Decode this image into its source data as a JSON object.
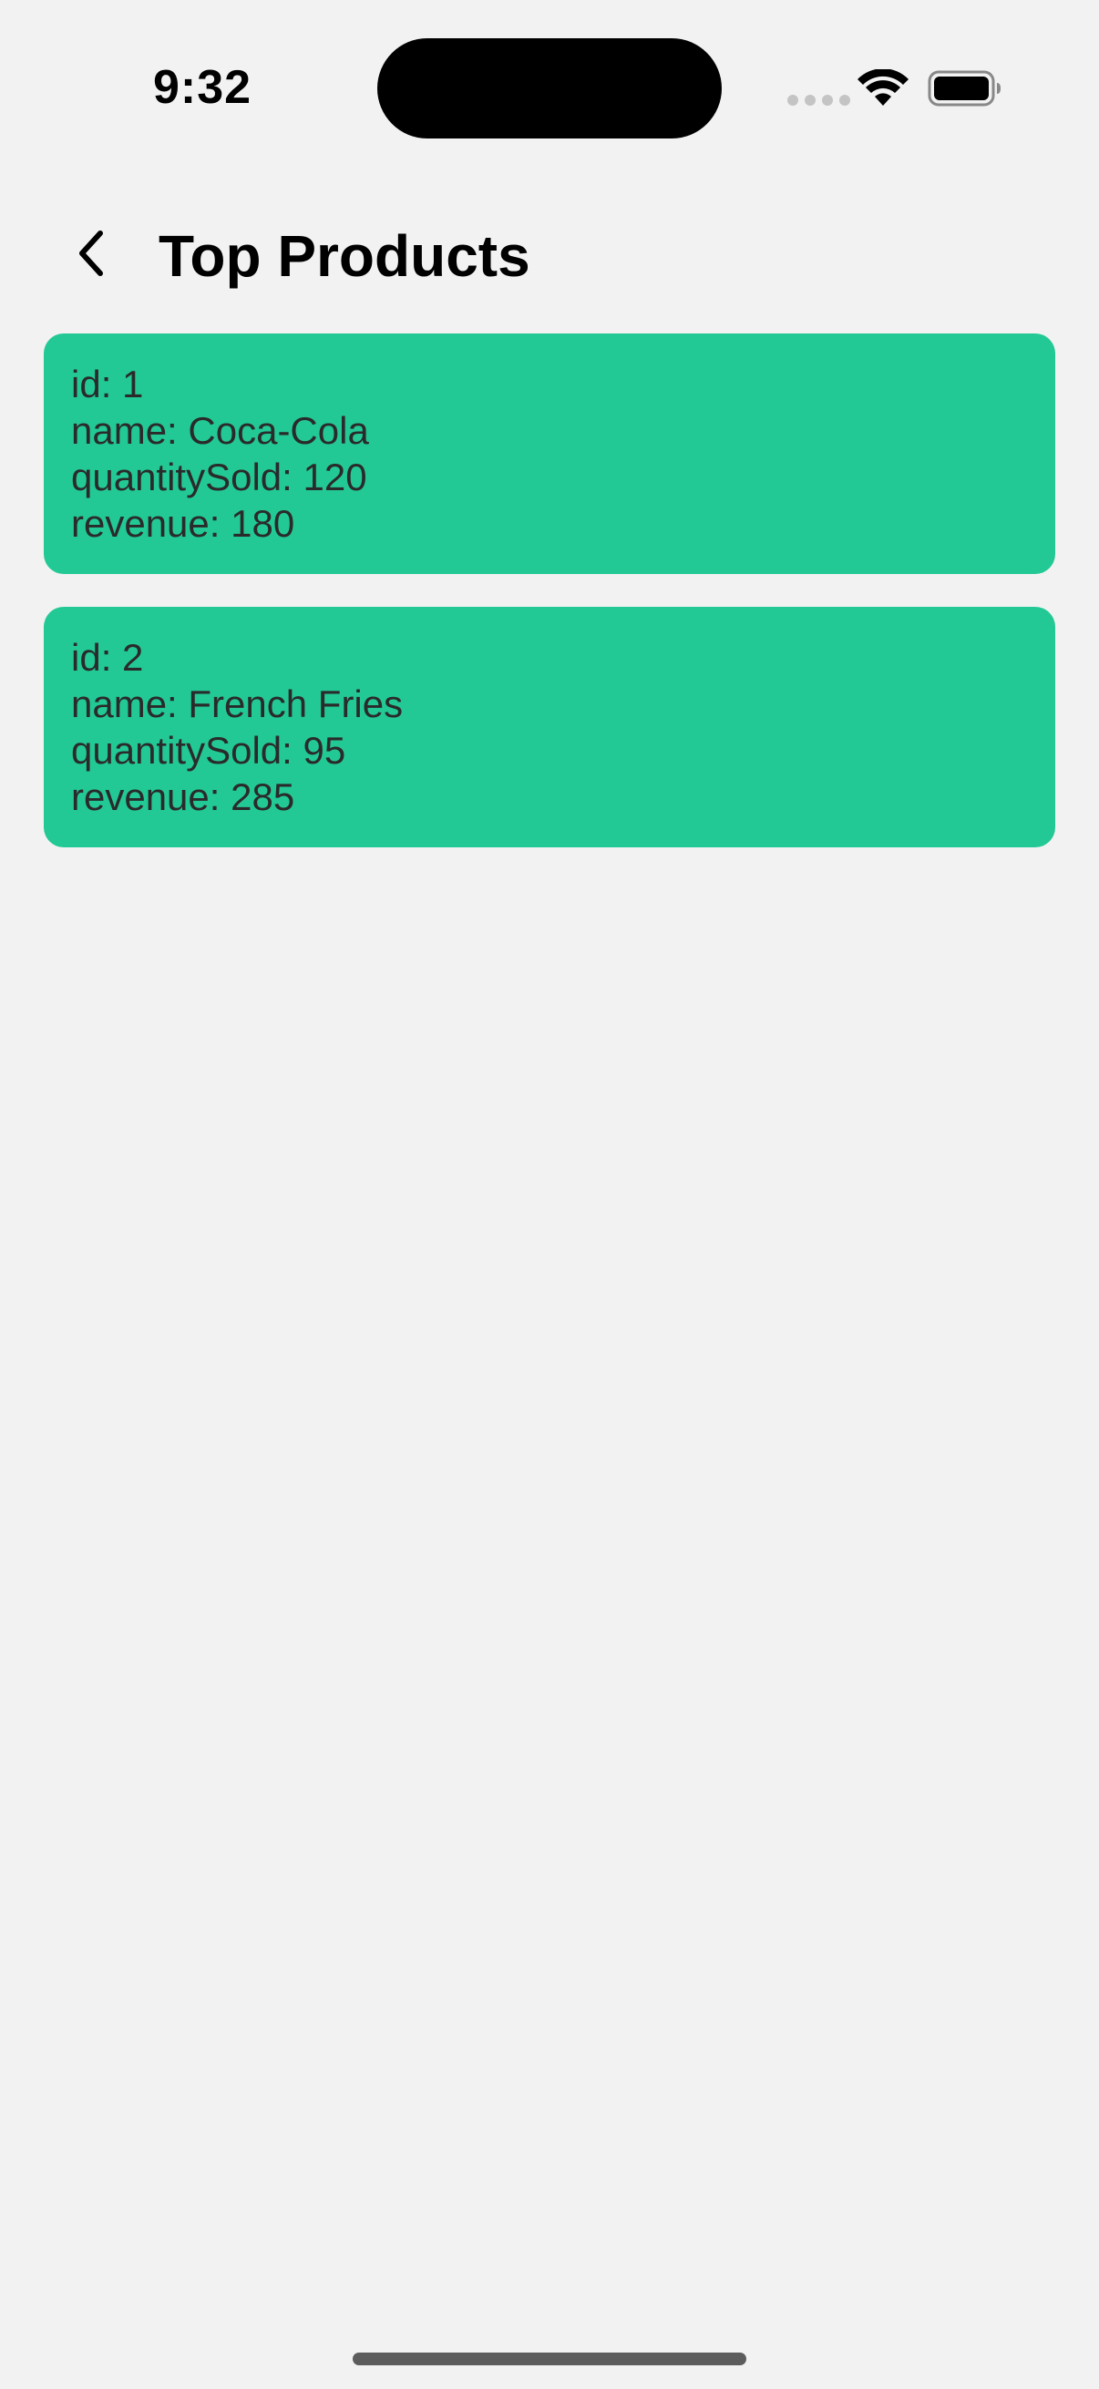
{
  "status_bar": {
    "time": "9:32"
  },
  "header": {
    "title": "Top Products",
    "back_icon": "chevron-left-icon"
  },
  "colors": {
    "background": "#f2f2f2",
    "card": "#23c995",
    "text": "#2a2a2a"
  },
  "products": [
    {
      "id_line": "id: 1",
      "name_line": "name: Coca-Cola",
      "quantity_line": "quantitySold: 120",
      "revenue_line": "revenue: 180"
    },
    {
      "id_line": "id: 2",
      "name_line": "name: French Fries",
      "quantity_line": "quantitySold: 95",
      "revenue_line": "revenue: 285"
    }
  ]
}
